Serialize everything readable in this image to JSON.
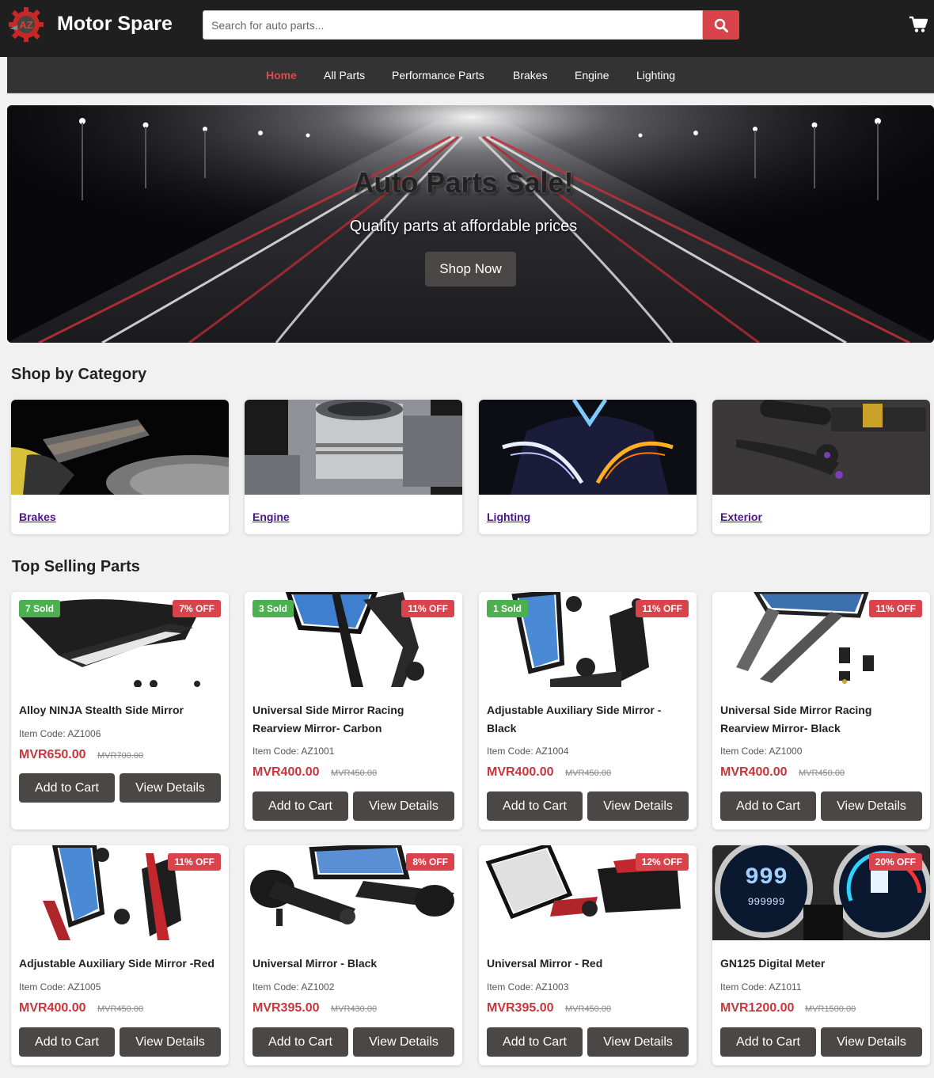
{
  "header": {
    "brand": "Motor Spare",
    "search_placeholder": "Search for auto parts...",
    "search_icon": "search-icon",
    "cart_icon": "cart-icon"
  },
  "nav": {
    "items": [
      "Home",
      "All Parts",
      "Performance Parts",
      "Brakes",
      "Engine",
      "Lighting"
    ],
    "active": "Home"
  },
  "hero": {
    "title": "Auto Parts Sale!",
    "subtitle": "Quality parts at affordable prices",
    "button": "Shop Now"
  },
  "categories": {
    "heading": "Shop by Category",
    "items": [
      {
        "label": "Brakes"
      },
      {
        "label": "Engine"
      },
      {
        "label": "Lighting"
      },
      {
        "label": "Exterior"
      }
    ]
  },
  "products": {
    "heading": "Top Selling Parts",
    "add_label": "Add to Cart",
    "view_label": "View Details",
    "items": [
      {
        "name": "Alloy NINJA Stealth Side Mirror",
        "code": "Item Code: AZ1006",
        "price": "MVR650.00",
        "old": "MVR700.00",
        "sold": "7 Sold",
        "off": "7% OFF"
      },
      {
        "name": "Universal Side Mirror Racing Rearview Mirror- Carbon",
        "code": "Item Code: AZ1001",
        "price": "MVR400.00",
        "old": "MVR450.00",
        "sold": "3 Sold",
        "off": "11% OFF"
      },
      {
        "name": "Adjustable Auxiliary Side Mirror - Black",
        "code": "Item Code: AZ1004",
        "price": "MVR400.00",
        "old": "MVR450.00",
        "sold": "1 Sold",
        "off": "11% OFF"
      },
      {
        "name": "Universal Side Mirror Racing Rearview Mirror- Black",
        "code": "Item Code: AZ1000",
        "price": "MVR400.00",
        "old": "MVR450.00",
        "sold": "",
        "off": "11% OFF"
      },
      {
        "name": "Adjustable Auxiliary Side Mirror -Red",
        "code": "Item Code: AZ1005",
        "price": "MVR400.00",
        "old": "MVR450.00",
        "sold": "",
        "off": "11% OFF"
      },
      {
        "name": "Universal Mirror - Black",
        "code": "Item Code: AZ1002",
        "price": "MVR395.00",
        "old": "MVR430.00",
        "sold": "",
        "off": "8% OFF"
      },
      {
        "name": "Universal Mirror - Red",
        "code": "Item Code: AZ1003",
        "price": "MVR395.00",
        "old": "MVR450.00",
        "sold": "",
        "off": "12% OFF"
      },
      {
        "name": "GN125 Digital Meter",
        "code": "Item Code: AZ1011",
        "price": "MVR1200.00",
        "old": "MVR1500.00",
        "sold": "",
        "off": "20% OFF"
      }
    ]
  },
  "colors": {
    "accent": "#d9434b",
    "header_bg": "#1f1f1f",
    "nav_bg": "#333333",
    "button_bg": "#4b4747",
    "sold_badge": "#4caf50"
  }
}
